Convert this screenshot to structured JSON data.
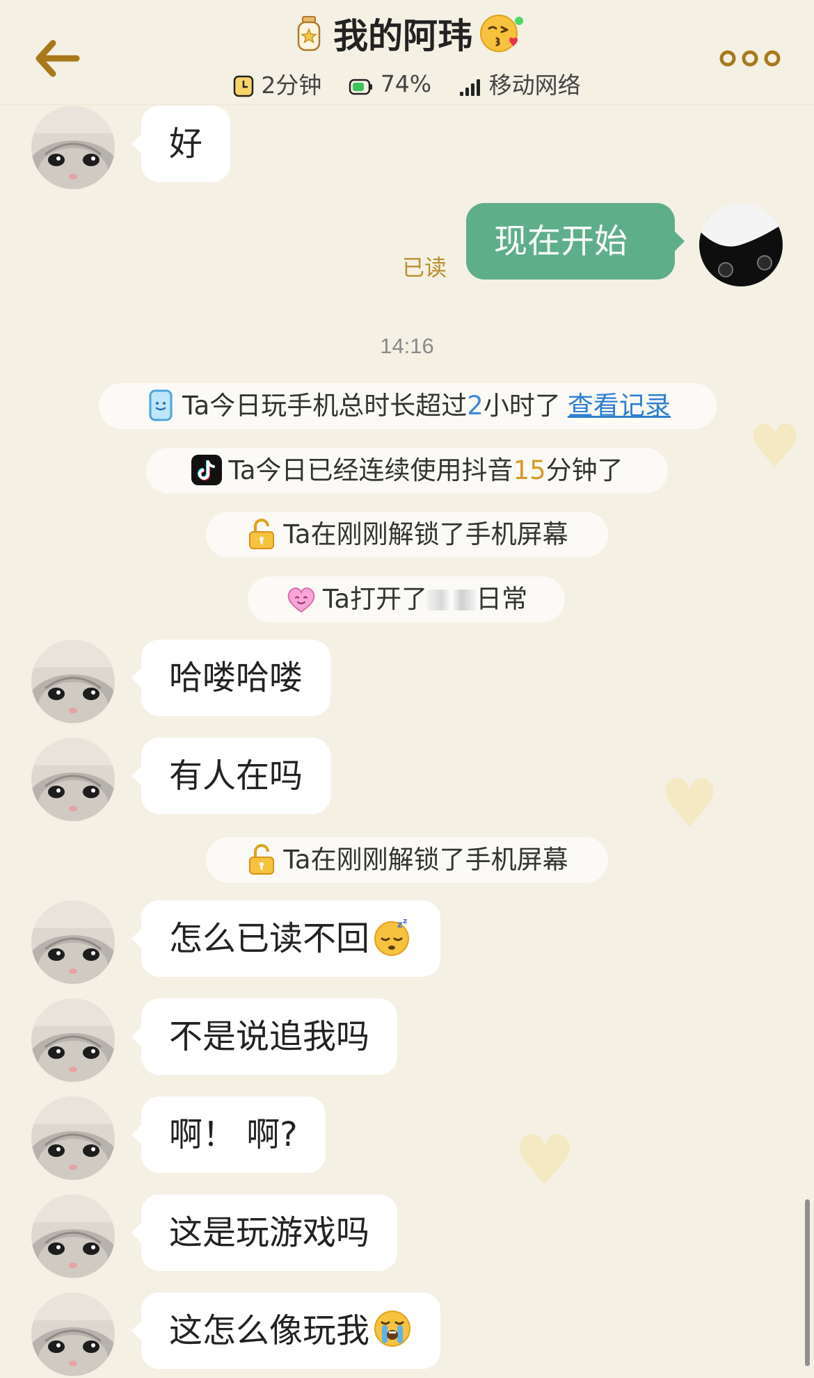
{
  "header": {
    "contact_name": "我的阿玮",
    "status_items": [
      {
        "icon": "timer-icon",
        "label": "2分钟"
      },
      {
        "icon": "battery-icon",
        "label": "74%"
      },
      {
        "icon": "signal-icon",
        "label": "移动网络"
      }
    ],
    "online": true
  },
  "messages": {
    "m1": "好",
    "m2": "现在开始",
    "m2_read": "已读",
    "time": "14:16",
    "m3": "哈喽哈喽",
    "m4": "有人在吗",
    "m5": "怎么已读不回",
    "m6": "不是说追我吗",
    "m7": "啊！ 啊?",
    "m8": "这是玩游戏吗",
    "m9": "这怎么像玩我"
  },
  "notices": {
    "phone_time": {
      "prefix": "Ta今日玩手机总时长超过",
      "value": "2",
      "suffix": "小时了",
      "link": "查看记录"
    },
    "douyin": {
      "prefix": "Ta今日已经连续使用抖音",
      "value": "15",
      "suffix": "分钟了"
    },
    "unlock": "Ta在刚刚解锁了手机屏幕",
    "opened_app": {
      "prefix": "Ta打开了",
      "suffix": "日常"
    },
    "unlock2": "Ta在刚刚解锁了手机屏幕"
  },
  "colors": {
    "background": "#f4f0e4",
    "outgoing_bubble": "#5fae8a",
    "incoming_bubble": "#ffffff",
    "read_label": "#b8902e",
    "link": "#2f7fd2",
    "accent_gold": "#a8781a"
  }
}
